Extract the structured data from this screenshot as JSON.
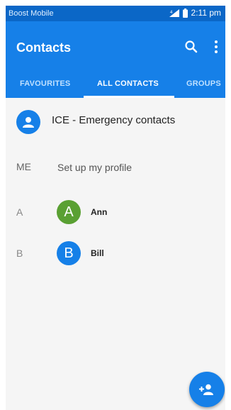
{
  "status_bar": {
    "carrier": "Boost Mobile",
    "time": "2:11 pm",
    "signal_icon": "signal-icon",
    "battery_icon": "battery-icon"
  },
  "app_bar": {
    "title": "Contacts",
    "search_icon": "search-icon",
    "more_icon": "more-vert-icon",
    "color": "#1680e8"
  },
  "tabs": [
    {
      "label": "FAVOURITES"
    },
    {
      "label": "ALL CONTACTS",
      "active": true
    },
    {
      "label": "GROUPS"
    }
  ],
  "ice": {
    "label": "ICE - Emergency contacts",
    "icon": "person-icon"
  },
  "me": {
    "section": "ME",
    "label": "Set up my profile"
  },
  "contacts": [
    {
      "section": "A",
      "initial": "A",
      "name": "Ann",
      "color": "#5aa033"
    },
    {
      "section": "B",
      "initial": "B",
      "name": "Bill",
      "color": "#1680e8"
    }
  ],
  "fab": {
    "icon": "add-person-icon"
  }
}
